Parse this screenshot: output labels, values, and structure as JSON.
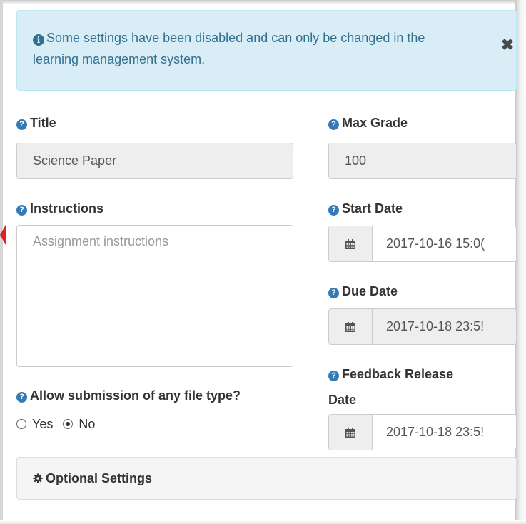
{
  "alert": {
    "icon": "info-circle-icon",
    "text": "Some settings have been disabled and can only be changed in the learning management system.",
    "close_icon": "close-icon"
  },
  "fields": {
    "title": {
      "label": "Title",
      "value": "Science Paper"
    },
    "max_grade": {
      "label": "Max Grade",
      "value": "100"
    },
    "instructions": {
      "label": "Instructions",
      "placeholder": "Assignment instructions"
    },
    "start_date": {
      "label": "Start Date",
      "value": "2017-10-16 15:0("
    },
    "due_date": {
      "label": "Due Date",
      "value": "2017-10-18 23:5!"
    },
    "feedback_release_date": {
      "label_line1": "Feedback Release",
      "label_line2": "Date",
      "value": "2017-10-18 23:5!"
    },
    "allow_any_file_type": {
      "label": "Allow submission of any file type?",
      "options": [
        "Yes",
        "No"
      ],
      "selected": "No"
    }
  },
  "optional_settings": {
    "label": "Optional Settings",
    "icon": "gear-icon"
  },
  "colors": {
    "alert_bg": "#d9edf7",
    "alert_text": "#31708f",
    "help_icon": "#337ab7",
    "disabled_bg": "#eeeeee"
  }
}
